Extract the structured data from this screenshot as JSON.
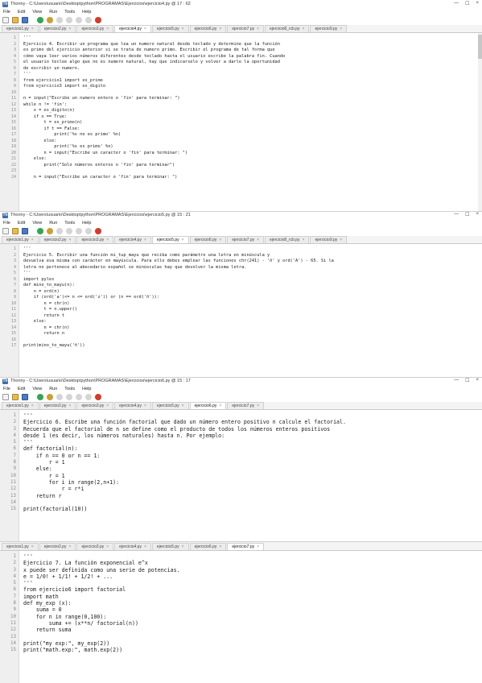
{
  "windows": [
    {
      "title": "Thonny - C:\\Users\\usuario\\Desktop\\python\\PROGRAMAS\\Ejercicios\\ejercicio4.py @ 17 : 62",
      "menu": [
        "File",
        "Edit",
        "View",
        "Run",
        "Tools",
        "Help"
      ],
      "tabs": [
        "ejercicio1.py",
        "ejercicio2.py",
        "ejercicio3.py",
        "ejercicio4.py",
        "ejercicio5.py",
        "ejercicio6.py",
        "ejercicio7.py",
        "ejercicio8_rcb.py",
        "ejercicio9.py"
      ],
      "active_tab": 3,
      "start_line": 1,
      "lines": [
        "'''",
        "Ejercicio 4. Escribir un programa que lea un numero natural desde teclado y determine que la función",
        "es primo del ejercicio anterior si se trata de numero primo. Escribir el programa de tal forma que",
        "cómo vaya leer varios números diferentes desde teclado hasta el usuario escribe la palabra fin. Cuando",
        "el usuario teclee algo que no es numero natural, hay que indicarselo y volver a darle la oportunidad",
        "de escribir un numero.",
        "'''",
        "from ejercicio1 import es_primo",
        "from ejercicio3 import es_digito",
        "",
        "n = input(\"Escribe un numero entero o 'fin' para terminar: \")",
        "while n != 'fin':",
        "    x = es_digito(n)",
        "    if x == True:",
        "        t = es_primo(n)",
        "        if t == False:",
        "            print('%s no es primo' %n)",
        "        else:",
        "            print('%s es primo' %n)",
        "        n = input(\"Escribe un caracter o 'fin' para terminar: \")",
        "    else:",
        "        print(\"Solo números enteros o 'fin' para terminar\")",
        "",
        "    n = input(\"Escribe un caracter o 'fin' para terminar: \")"
      ]
    },
    {
      "title": "Thonny - C:\\Users\\usuario\\Desktop\\python\\PROGRAMAS\\Ejercicios\\ejercicio5.py @ 15 : 21",
      "menu": [
        "File",
        "Edit",
        "View",
        "Run",
        "Tools",
        "Help"
      ],
      "tabs": [
        "ejercicio1.py",
        "ejercicio2.py",
        "ejercicio3.py",
        "ejercicio4.py",
        "ejercicio5.py",
        "ejercicio6.py",
        "ejercicio7.py",
        "ejercicio8_rcb.py",
        "ejercicio9.py"
      ],
      "active_tab": 4,
      "start_line": 1,
      "lines": [
        "'''",
        "Ejercicio 5. Escribir una función mi_tup_mayu que reciba como parámetro una letra en minúscula y",
        "devuelva esa misma con carácter en mayúscula. Para ello debes emplear las funciones chr(241) - 'ñ' y ord('A') - 65. Si la",
        "letra no pertenece al abecedario español se minúsculas hay que devolver la misma letra.",
        "'''",
        "import pyles",
        "def mino_to_mayu(n):",
        "    n = ord(n)",
        "    if (ord('a')<= n <= ord('z')) or (n == ord('ñ')):",
        "        n = chr(n)",
        "        t = n.upper()",
        "        return t",
        "    else:",
        "        n = chr(n)",
        "        return n",
        "",
        "print(mino_to_mayu('ñ'))"
      ]
    },
    {
      "title": "Thonny - C:\\Users\\usuario\\Desktop\\python\\PROGRAMAS\\Ejercicios\\ejercicio6.py @ 15 : 17",
      "menu": [
        "File",
        "Edit",
        "View",
        "Run",
        "Tools",
        "Help"
      ],
      "tabs": [
        "ejercicio1.py",
        "ejercicio2.py",
        "ejercicio3.py",
        "ejercicio4.py",
        "ejercicio5.py",
        "ejercicio6.py",
        "ejercicio7.py"
      ],
      "active_tab": 5,
      "start_line": 1,
      "lines": [
        "'''",
        "Ejercicio 6. Escribe una función factorial que dado un número entero positivo n calcule el factorial.",
        "Recuerda que el factorial de n se define como el producto de todos los números enteros positivos",
        "desde 1 (es decir, los números naturales) hasta n. Por ejemplo:",
        "'''",
        "def factorial(n):",
        "    if n == 0 or n == 1:",
        "        r = 1",
        "    else:",
        "        r = 1",
        "        for i in range(2,n+1):",
        "            r = r*i",
        "    return r",
        "",
        "print(factorial(10))"
      ]
    },
    {
      "title": "",
      "menu": [],
      "tabs": [
        "ejercicio1.py",
        "ejercicio2.py",
        "ejercicio3.py",
        "ejercicio4.py",
        "ejercicio5.py",
        "ejercicio6.py",
        "ejercicio7.py"
      ],
      "active_tab": 6,
      "start_line": 1,
      "lines": [
        "'''",
        "Ejercicio 7. La función exponencial e^x",
        "x puede ser definida como una serie de potencias.",
        "e = 1/0! + 1/1! + 1/2! + ...",
        "'''",
        "from ejercicio6 import factorial",
        "import math",
        "def my_exp (x):",
        "    suma = 0",
        "    for n in range(0,100):",
        "        suma += (x**n/ factorial(n))",
        "    return suma",
        "",
        "print(\"my exp:\", my_exp(2))",
        "print(\"math.exp:\", math.exp(2))"
      ]
    }
  ],
  "ui": {
    "app_icon": "Th",
    "close_glyph": "×",
    "minimize_glyph": "—",
    "maximize_glyph": "☐"
  }
}
